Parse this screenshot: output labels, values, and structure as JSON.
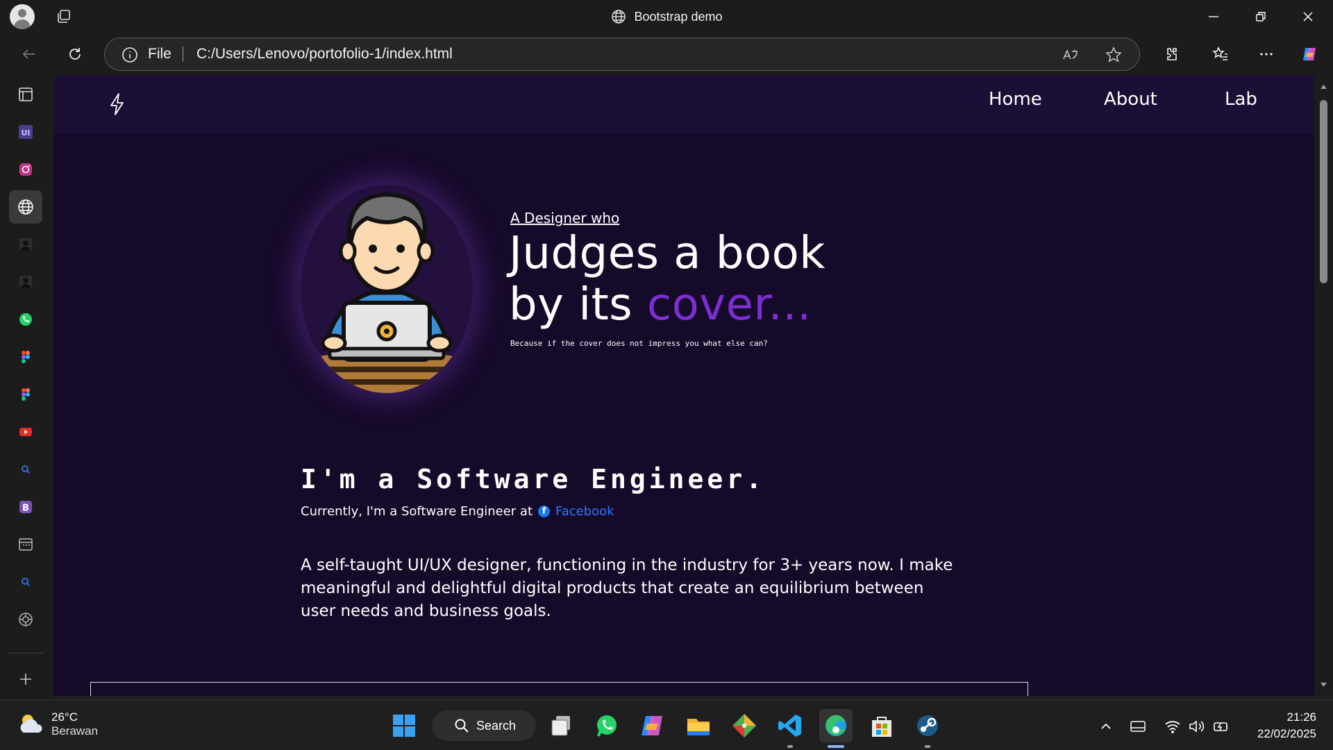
{
  "browser": {
    "window_title": "Bootstrap demo",
    "address": {
      "scheme_label": "File",
      "url": "C:/Users/Lenovo/portofolio-1/index.html"
    }
  },
  "site": {
    "nav": {
      "links": [
        "Home",
        "About",
        "Lab"
      ]
    },
    "hero": {
      "subtitle": "A Designer who",
      "title_line1": "Judges a book",
      "title_line2_prefix": "by its ",
      "title_accent": "cover...",
      "tagline": "Because if the cover does not impress you what else can?"
    },
    "about": {
      "heading": "I'm a Software Engineer.",
      "current_prefix": "Currently, I'm a Software Engineer at",
      "company": "Facebook",
      "bio": "A self-taught UI/UX designer, functioning in the industry for 3+ years now. I make meaningful and delightful digital products that create an equilibrium between user needs and business goals."
    },
    "colors": {
      "background": "#160a2a",
      "nav_background": "#1c0f35",
      "accent": "#7b2fd0",
      "link": "#2a7bff"
    }
  },
  "taskbar": {
    "weather": {
      "temperature": "26°C",
      "condition": "Berawan"
    },
    "search_label": "Search",
    "clock": {
      "time": "21:26",
      "date": "22/02/2025"
    }
  }
}
